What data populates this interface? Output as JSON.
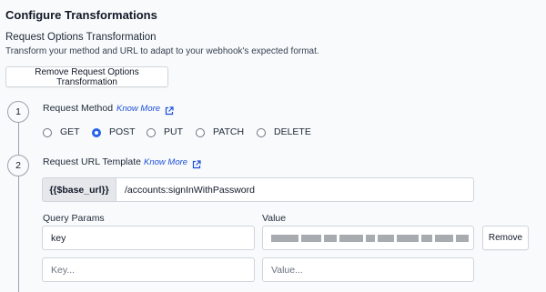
{
  "section": {
    "title": "Configure Transformations",
    "subtitle": "Request Options Transformation",
    "description": "Transform your method and URL to adapt to your webhook's expected format.",
    "remove_button": "Remove Request Options Transformation"
  },
  "steps": [
    {
      "number": "1",
      "label": "Request Method",
      "know_more": "Know More"
    },
    {
      "number": "2",
      "label": "Request URL Template",
      "know_more": "Know More"
    }
  ],
  "methods": {
    "options": [
      "GET",
      "POST",
      "PUT",
      "PATCH",
      "DELETE"
    ],
    "selected": "POST"
  },
  "url_template": {
    "prefix": "{{$base_url}}",
    "value": "/accounts:signInWithPassword"
  },
  "query_params": {
    "key_header": "Query Params",
    "value_header": "Value",
    "rows": [
      {
        "key": "key",
        "value": "(redacted)",
        "remove_label": "Remove"
      }
    ],
    "new_key_placeholder": "Key...",
    "new_value_placeholder": "Value..."
  },
  "colors": {
    "accent": "#2563eb",
    "link": "#1d4ed8",
    "background": "#f8fafc"
  },
  "icons": [
    "external-link-icon"
  ]
}
